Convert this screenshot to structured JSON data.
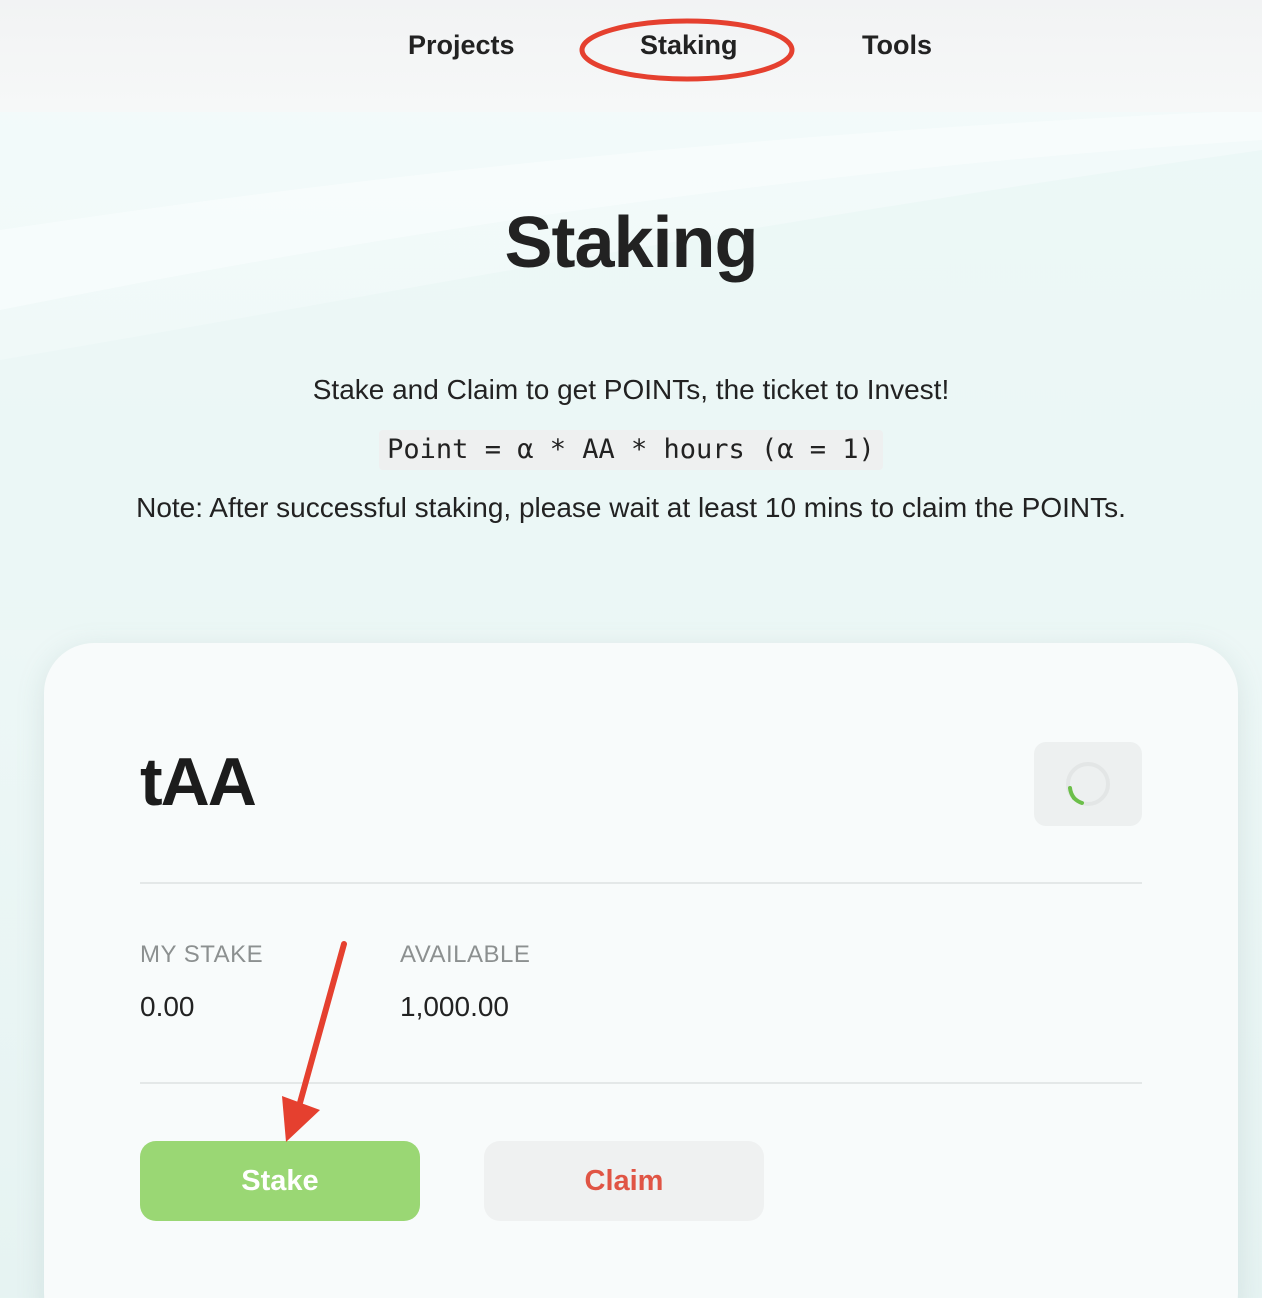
{
  "nav": {
    "items": [
      {
        "label": "Projects"
      },
      {
        "label": "Staking"
      },
      {
        "label": "Tools"
      }
    ],
    "active": "Staking"
  },
  "hero": {
    "title": "Staking",
    "subtitle": "Stake and Claim to get POINTs, the ticket to Invest!",
    "formula": "Point = α * AA * hours (α = 1)",
    "note": "Note: After successful staking, please wait at least 10 mins to claim the POINTs."
  },
  "card": {
    "token": "tAA",
    "refresh_icon": "loading-spinner-icon",
    "my_stake_label": "MY STAKE",
    "my_stake_value": "0.00",
    "available_label": "AVAILABLE",
    "available_value": "1,000.00",
    "stake_button": "Stake",
    "claim_button": "Claim"
  },
  "annotations": {
    "highlight_color": "#e5402f",
    "highlight_target": "Staking",
    "arrow_target": "Stake"
  },
  "colors": {
    "stake_button": "#9ad774",
    "claim_text": "#e05545",
    "spinner_accent": "#6cbf4a"
  }
}
